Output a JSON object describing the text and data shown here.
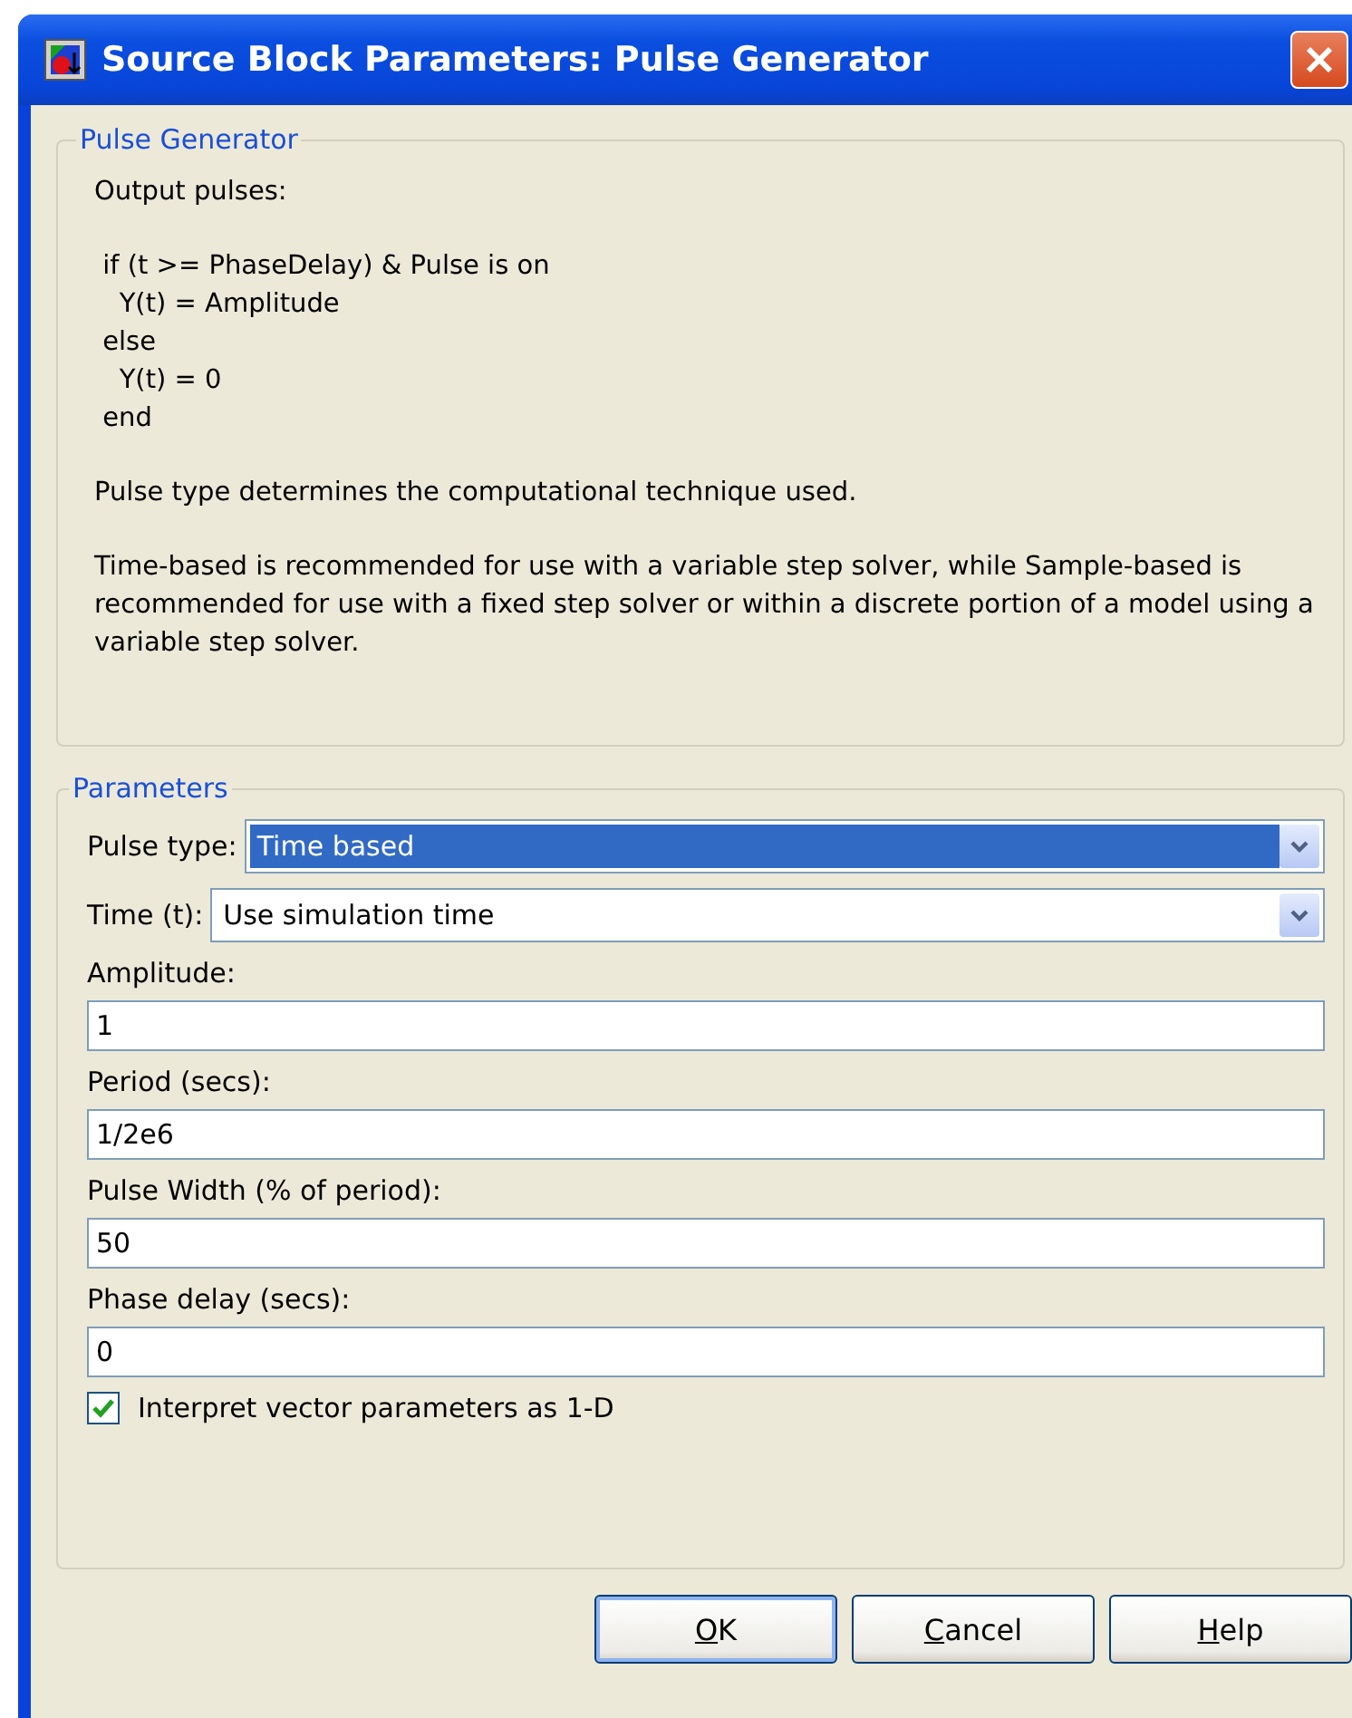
{
  "window": {
    "title": "Source Block Parameters: Pulse Generator"
  },
  "description_group": {
    "title": "Pulse Generator",
    "intro": "Output pulses:",
    "code": " if (t >= PhaseDelay) & Pulse is on\n   Y(t) = Amplitude\n else\n   Y(t) = 0\n end",
    "paragraphs": [
      "Pulse type determines the computational technique used.",
      "Time-based is recommended for use with a variable step solver, while Sample-based is recommended for use with a fixed step solver or within a discrete portion of a model using a variable step solver."
    ]
  },
  "parameters_group": {
    "title": "Parameters",
    "items": [
      {
        "kind": "dropdown",
        "label": "Pulse type:",
        "value": "Time based",
        "highlighted": true
      },
      {
        "kind": "dropdown",
        "label": "Time (t):",
        "value": "Use simulation time",
        "highlighted": false
      },
      {
        "kind": "field",
        "label": "Amplitude:",
        "value": "1"
      },
      {
        "kind": "field",
        "label": "Period (secs):",
        "value": "1/2e6"
      },
      {
        "kind": "field",
        "label": "Pulse Width (% of period):",
        "value": "50"
      },
      {
        "kind": "field",
        "label": "Phase delay (secs):",
        "value": "0"
      },
      {
        "kind": "checkbox",
        "label": "Interpret vector parameters as 1-D",
        "checked": true
      }
    ]
  },
  "buttons": [
    {
      "mnemonic": "O",
      "rest": "K",
      "default": true
    },
    {
      "mnemonic": "C",
      "rest": "ancel",
      "default": false
    },
    {
      "mnemonic": "H",
      "rest": "elp",
      "default": false
    }
  ]
}
